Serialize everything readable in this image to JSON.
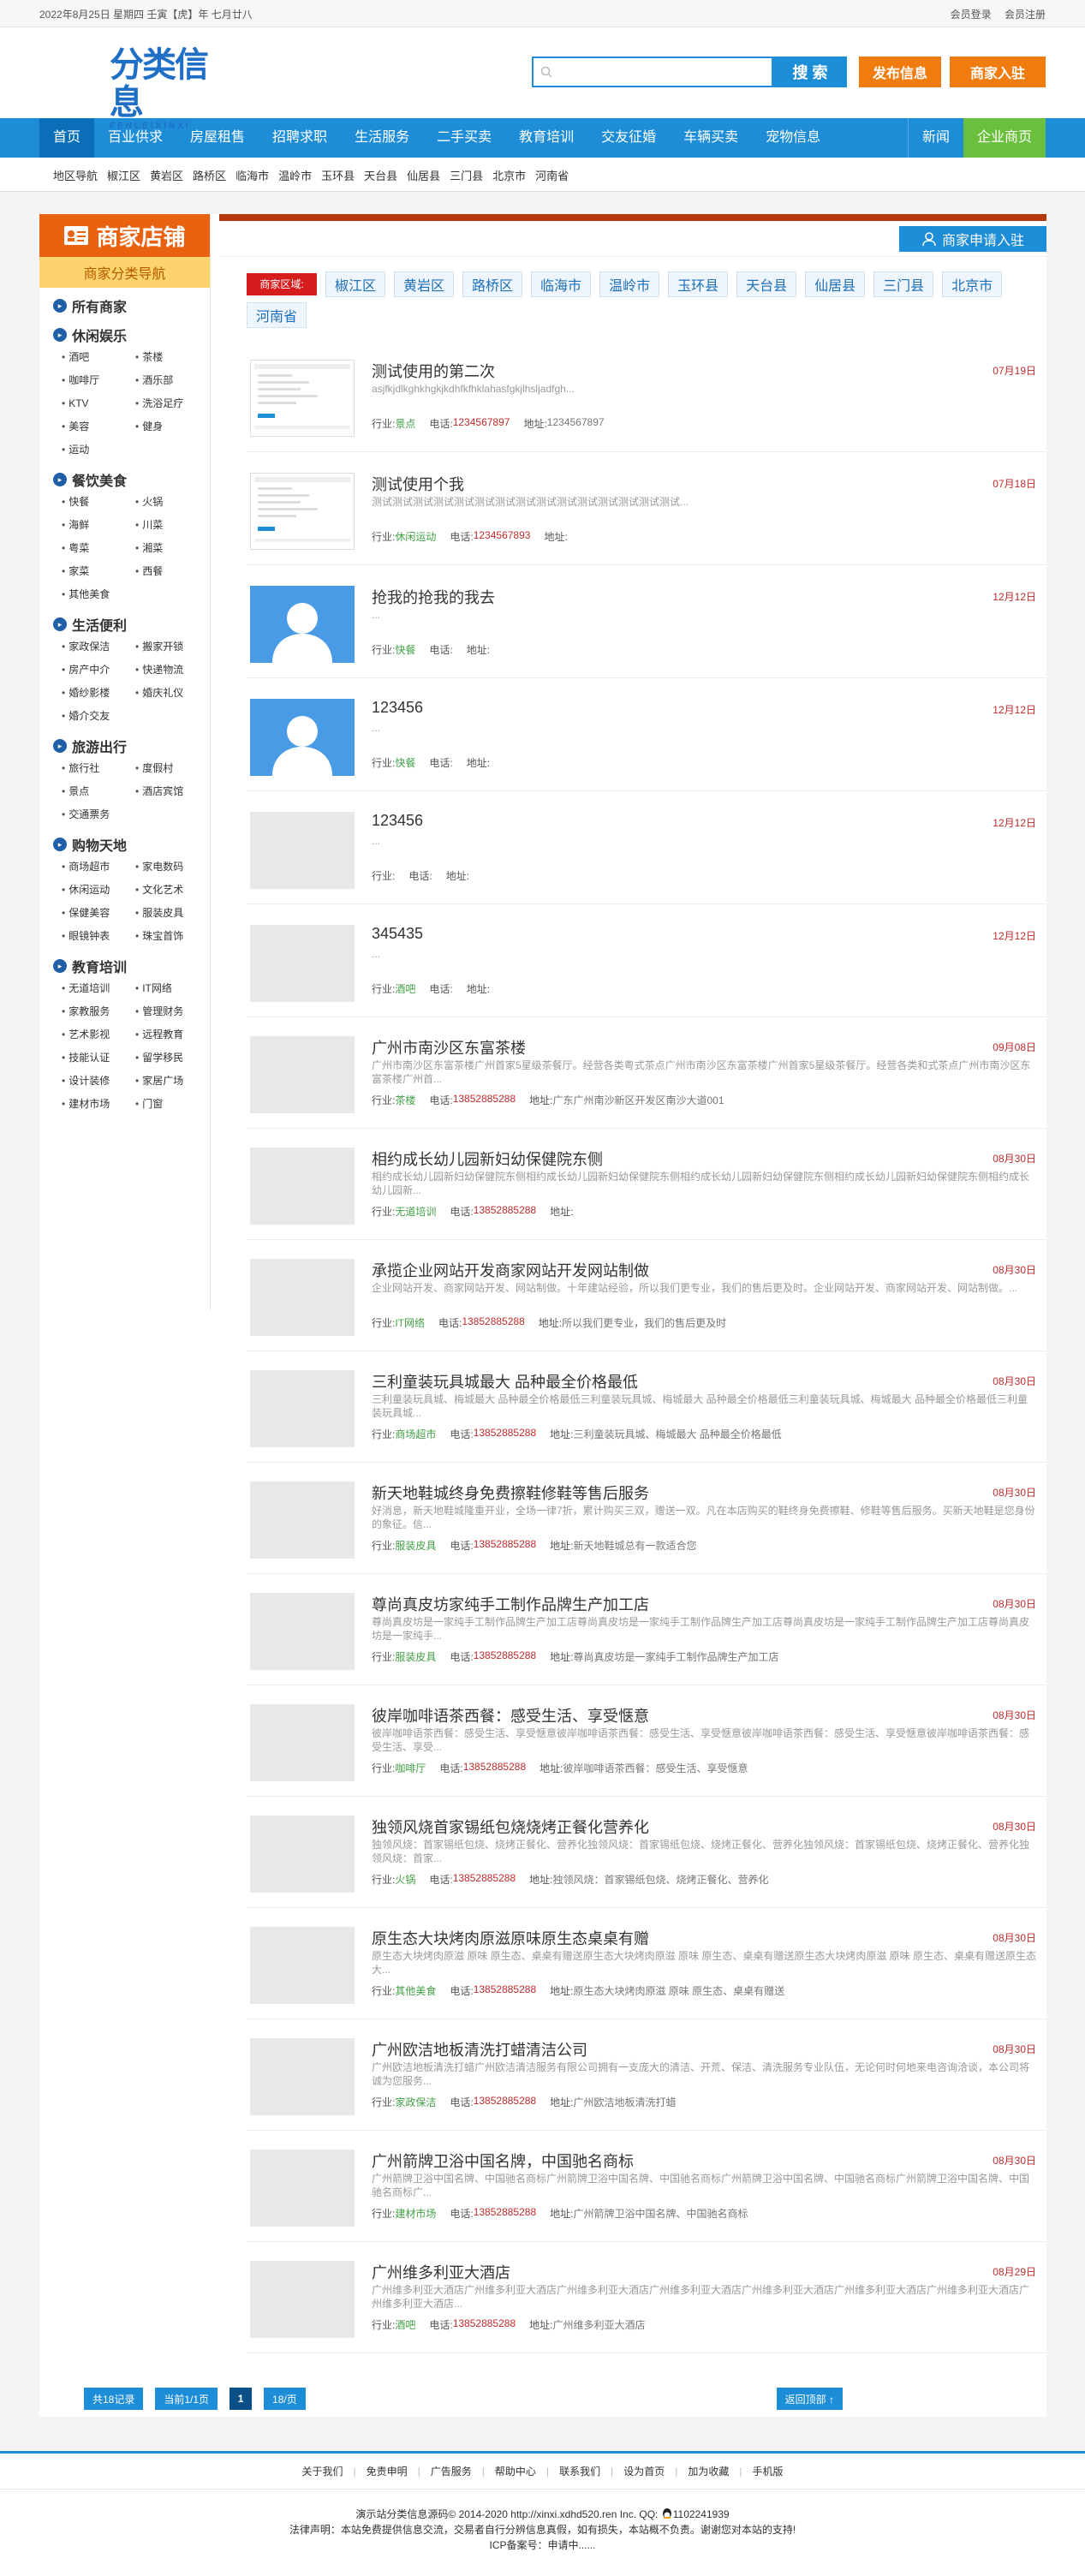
{
  "topbar": {
    "date": "2022年8月25日 星期四 壬寅【虎】年 七月廿八",
    "login": "会员登录",
    "register": "会员注册"
  },
  "header": {
    "logo_cn": "分类信息",
    "logo_en": "FENLEIXINXI",
    "search_placeholder": "",
    "search_btn": "搜 索",
    "post_btn": "发布信息",
    "join_btn": "商家入驻"
  },
  "nav": {
    "items": [
      "首页",
      "百业供求",
      "房屋租售",
      "招聘求职",
      "生活服务",
      "二手买卖",
      "教育培训",
      "交友征婚",
      "车辆买卖",
      "宠物信息"
    ],
    "news": "新闻",
    "biz": "企业商页"
  },
  "subnav": {
    "items": [
      "地区导航",
      "椒江区",
      "黄岩区",
      "路桥区",
      "临海市",
      "温岭市",
      "玉环县",
      "天台县",
      "仙居县",
      "三门县",
      "北京市",
      "河南省"
    ]
  },
  "sidebar": {
    "head": "商家店铺",
    "sub": "商家分类导航",
    "sections": [
      {
        "title": "所有商家",
        "items": []
      },
      {
        "title": "休闲娱乐",
        "items": [
          "酒吧",
          "茶楼",
          "咖啡厅",
          "酒乐部",
          "KTV",
          "洗浴足疗",
          "美容",
          "健身",
          "运动"
        ]
      },
      {
        "title": "餐饮美食",
        "items": [
          "快餐",
          "火锅",
          "海鲜",
          "川菜",
          "粤菜",
          "湘菜",
          "家菜",
          "西餐",
          "其他美食"
        ]
      },
      {
        "title": "生活便利",
        "items": [
          "家政保洁",
          "搬家开锁",
          "房产中介",
          "快递物流",
          "婚纱影楼",
          "婚庆礼仪",
          "婚介交友"
        ]
      },
      {
        "title": "旅游出行",
        "items": [
          "旅行社",
          "度假村",
          "景点",
          "酒店宾馆",
          "交通票务"
        ]
      },
      {
        "title": "购物天地",
        "items": [
          "商场超市",
          "家电数码",
          "休闲运动",
          "文化艺术",
          "保健美容",
          "服装皮具",
          "眼镜钟表",
          "珠宝首饰"
        ]
      },
      {
        "title": "教育培训",
        "items": [
          "无道培训",
          "IT网络",
          "家教服务",
          "管理财务",
          "艺术影视",
          "远程教育",
          "技能认证",
          "留学移民",
          "设计装修",
          "家居广场",
          "建材市场",
          "门窗"
        ]
      }
    ]
  },
  "content": {
    "join_btn": "商家申请入驻",
    "region_label": "商家区域:",
    "regions": [
      "椒江区",
      "黄岩区",
      "路桥区",
      "临海市",
      "温岭市",
      "玉环县",
      "天台县",
      "仙居县",
      "三门县",
      "北京市",
      "河南省"
    ],
    "lbl_cat": "行业:",
    "lbl_phone": "电话:",
    "lbl_addr": "地址:",
    "listings": [
      {
        "title": "测试使用的第二次",
        "date": "07月19日",
        "desc": "asjfkjdlkghkhgkjkdhfkfhklahasfgkjlhsljadfgh...",
        "cat": "景点",
        "phone": "1234567897",
        "addr": "1234567897",
        "thumb": "shot"
      },
      {
        "title": "测试使用个我",
        "date": "07月18日",
        "desc": "测试测试测试测试测试测试测试测试测试测试测试测试测试测试测试...",
        "cat": "休闲运动",
        "phone": "1234567893",
        "addr": "",
        "thumb": "shot"
      },
      {
        "title": "抢我的抢我的我去",
        "date": "12月12日",
        "desc": "...",
        "cat": "快餐",
        "phone": "",
        "addr": "",
        "thumb": "avatar"
      },
      {
        "title": "123456",
        "date": "12月12日",
        "desc": "...",
        "cat": "快餐",
        "phone": "",
        "addr": "",
        "thumb": "avatar"
      },
      {
        "title": "123456",
        "date": "12月12日",
        "desc": "...",
        "cat": "",
        "phone": "",
        "addr": "",
        "thumb": "gray"
      },
      {
        "title": "345435",
        "date": "12月12日",
        "desc": "...",
        "cat": "酒吧",
        "phone": "",
        "addr": "",
        "thumb": "gray"
      },
      {
        "title": "广州市南沙区东富茶楼",
        "date": "09月08日",
        "desc": "广州市南沙区东富茶楼广州首家5星级茶餐厅。经营各类粤式茶点广州市南沙区东富茶楼广州首家5星级茶餐厅。经营各类和式茶点广州市南沙区东富茶楼广州首...",
        "cat": "茶楼",
        "phone": "13852885288",
        "addr": "广东广州南沙新区开发区南沙大道001",
        "thumb": "gray"
      },
      {
        "title": "相约成长幼儿园新妇幼保健院东侧",
        "date": "08月30日",
        "desc": "相约成长幼儿园新妇幼保健院东侧相约成长幼儿园新妇幼保健院东侧相约成长幼儿园新妇幼保健院东侧相约成长幼儿园新妇幼保健院东侧相约成长幼儿园新...",
        "cat": "无道培训",
        "phone": "13852885288",
        "addr": "",
        "thumb": "gray"
      },
      {
        "title": "承揽企业网站开发商家网站开发网站制做",
        "date": "08月30日",
        "desc": "企业网站开发、商家网站开发、网站制做。十年建站经验，所以我们更专业，我们的售后更及时。企业网站开发、商家网站开发、网站制做。...",
        "cat": "IT网络",
        "phone": "13852885288",
        "addr": "所以我们更专业，我们的售后更及时",
        "thumb": "gray"
      },
      {
        "title": "三利童装玩具城最大 品种最全价格最低",
        "date": "08月30日",
        "desc": "三利童装玩具城、梅城最大 品种最全价格最低三利童装玩具城、梅城最大 品种最全价格最低三利童装玩具城、梅城最大 品种最全价格最低三利童装玩具城...",
        "cat": "商场超市",
        "phone": "13852885288",
        "addr": "三利童装玩具城、梅城最大 品种最全价格最低",
        "thumb": "gray"
      },
      {
        "title": "新天地鞋城终身免费擦鞋修鞋等售后服务",
        "date": "08月30日",
        "desc": "好消息，新天地鞋城隆重开业，全场一律7折，累计购买三双，赠送一双。凡在本店购买的鞋终身免费擦鞋、修鞋等售后服务。买新天地鞋是您身份的象征。信...",
        "cat": "服装皮具",
        "phone": "13852885288",
        "addr": "新天地鞋城总有一款适合您",
        "thumb": "gray"
      },
      {
        "title": "尊尚真皮坊家纯手工制作品牌生产加工店",
        "date": "08月30日",
        "desc": "尊尚真皮坊是一家纯手工制作品牌生产加工店尊尚真皮坊是一家纯手工制作品牌生产加工店尊尚真皮坊是一家纯手工制作品牌生产加工店尊尚真皮坊是一家纯手...",
        "cat": "服装皮具",
        "phone": "13852885288",
        "addr": "尊尚真皮坊是一家纯手工制作品牌生产加工店",
        "thumb": "gray"
      },
      {
        "title": "彼岸咖啡语茶西餐：感受生活、享受惬意",
        "date": "08月30日",
        "desc": "彼岸咖啡语茶西餐：感受生活、享受惬意彼岸咖啡语茶西餐：感受生活、享受惬意彼岸咖啡语茶西餐：感受生活、享受惬意彼岸咖啡语茶西餐：感受生活、享受...",
        "cat": "咖啡厅",
        "phone": "13852885288",
        "addr": "彼岸咖啡语茶西餐：感受生活、享受惬意",
        "thumb": "gray"
      },
      {
        "title": "独领风烧首家锡纸包烧烧烤正餐化营养化",
        "date": "08月30日",
        "desc": "独领风烧：首家锡纸包烧、烧烤正餐化、营养化独领风烧：首家锡纸包烧、烧烤正餐化、营养化独领风烧：首家锡纸包烧、烧烤正餐化、营养化独领风烧：首家...",
        "cat": "火锅",
        "phone": "13852885288",
        "addr": "独领风烧：首家锡纸包烧、烧烤正餐化、营养化",
        "thumb": "gray"
      },
      {
        "title": "原生态大块烤肉原滋原味原生态桌桌有赠",
        "date": "08月30日",
        "desc": "原生态大块烤肉原滋 原味 原生态、桌桌有赠送原生态大块烤肉原滋 原味 原生态、桌桌有赠送原生态大块烤肉原滋 原味 原生态、桌桌有赠送原生态大...",
        "cat": "其他美食",
        "phone": "13852885288",
        "addr": "原生态大块烤肉原滋 原味 原生态、桌桌有赠送",
        "thumb": "gray"
      },
      {
        "title": "广州欧洁地板清洗打蜡清洁公司",
        "date": "08月30日",
        "desc": "广州欧洁地板清洗打蜡广州欧洁清洁服务有限公司拥有一支庞大的清洁、开荒、保洁、清洗服务专业队伍，无论何时何地来电咨询洽谈，本公司将诚为您服务...",
        "cat": "家政保洁",
        "phone": "13852885288",
        "addr": "广州欧洁地板清洗打蜡",
        "thumb": "gray"
      },
      {
        "title": "广州箭牌卫浴中国名牌，中国驰名商标",
        "date": "08月30日",
        "desc": "广州箭牌卫浴中国名牌、中国驰名商标广州箭牌卫浴中国名牌、中国驰名商标广州箭牌卫浴中国名牌、中国驰名商标广州箭牌卫浴中国名牌、中国驰名商标广...",
        "cat": "建材市场",
        "phone": "13852885288",
        "addr": "广州箭牌卫浴中国名牌、中国驰名商标",
        "thumb": "gray"
      },
      {
        "title": "广州维多利亚大酒店",
        "date": "08月29日",
        "desc": "广州维多利亚大酒店广州维多利亚大酒店广州维多利亚大酒店广州维多利亚大酒店广州维多利亚大酒店广州维多利亚大酒店广州维多利亚大酒店广州维多利亚大酒店...",
        "cat": "酒吧",
        "phone": "13852885288",
        "addr": "广州维多利亚大酒店",
        "thumb": "gray"
      }
    ]
  },
  "pager": {
    "total": "共18记录",
    "current": "当前1/1页",
    "page": "1",
    "per": "18/页",
    "top": "返回顶部 ↑"
  },
  "footer": {
    "links": [
      "关于我们",
      "免责申明",
      "广告服务",
      "帮助中心",
      "联系我们",
      "设为首页",
      "加为收藏",
      "手机版"
    ],
    "copy1": "演示站分类信息源码© 2014-2020 http://xinxi.xdhd520.ren Inc. QQ: ",
    "qq": "1102241939",
    "copy2": "法律声明：本站免费提供信息交流，交易者自行分辨信息真假，如有损失，本站概不负责。谢谢您对本站的支持!",
    "copy3": "ICP备案号：申请中......"
  },
  "colors": {
    "primary": "#1d8dd8",
    "orange": "#f07b0f",
    "green": "#6abf3c",
    "red": "#c02c2c"
  }
}
